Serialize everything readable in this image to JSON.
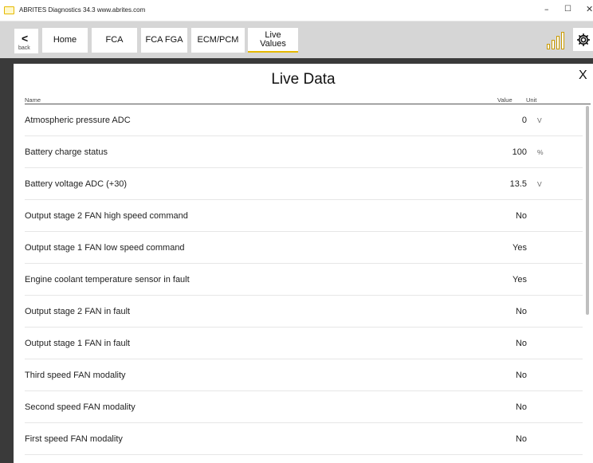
{
  "titlebar": {
    "title": "ABRITES Diagnostics 34.3  www.abrites.com",
    "minimize": "–",
    "maximize": "☐",
    "close": "✕"
  },
  "toolbar": {
    "back_label": "back",
    "back_glyph": "<",
    "tabs": [
      "Home",
      "FCA",
      "FCA FGA",
      "ECM/PCM"
    ],
    "live_values_line1": "Live",
    "live_values_line2": "Values"
  },
  "panel": {
    "title": "Live Data",
    "close": "X",
    "headers": {
      "name": "Name",
      "value": "Value",
      "unit": "Unit"
    },
    "rows": [
      {
        "name": "Atmospheric pressure ADC",
        "value": "0",
        "unit": "V"
      },
      {
        "name": "Battery charge status",
        "value": "100",
        "unit": "%"
      },
      {
        "name": "Battery voltage ADC (+30)",
        "value": "13.5",
        "unit": "V"
      },
      {
        "name": "Output stage 2 FAN high speed command",
        "value": "No",
        "unit": ""
      },
      {
        "name": "Output stage 1 FAN low speed command",
        "value": "Yes",
        "unit": ""
      },
      {
        "name": "Engine coolant temperature sensor in fault",
        "value": "Yes",
        "unit": ""
      },
      {
        "name": "Output stage 2 FAN in fault",
        "value": "No",
        "unit": ""
      },
      {
        "name": "Output stage 1 FAN in fault",
        "value": "No",
        "unit": ""
      },
      {
        "name": "Third speed FAN modality",
        "value": "No",
        "unit": ""
      },
      {
        "name": "Second speed FAN modality",
        "value": "No",
        "unit": ""
      },
      {
        "name": "First speed FAN modality",
        "value": "No",
        "unit": ""
      }
    ]
  },
  "icons": {
    "app": "abrites-app-icon",
    "signal": "signal-strength-icon",
    "settings": "gear-icon"
  },
  "colors": {
    "accent": "#e5b800",
    "toolbar_bg": "#d6d6d6",
    "frame_bg": "#3a3a3a"
  }
}
